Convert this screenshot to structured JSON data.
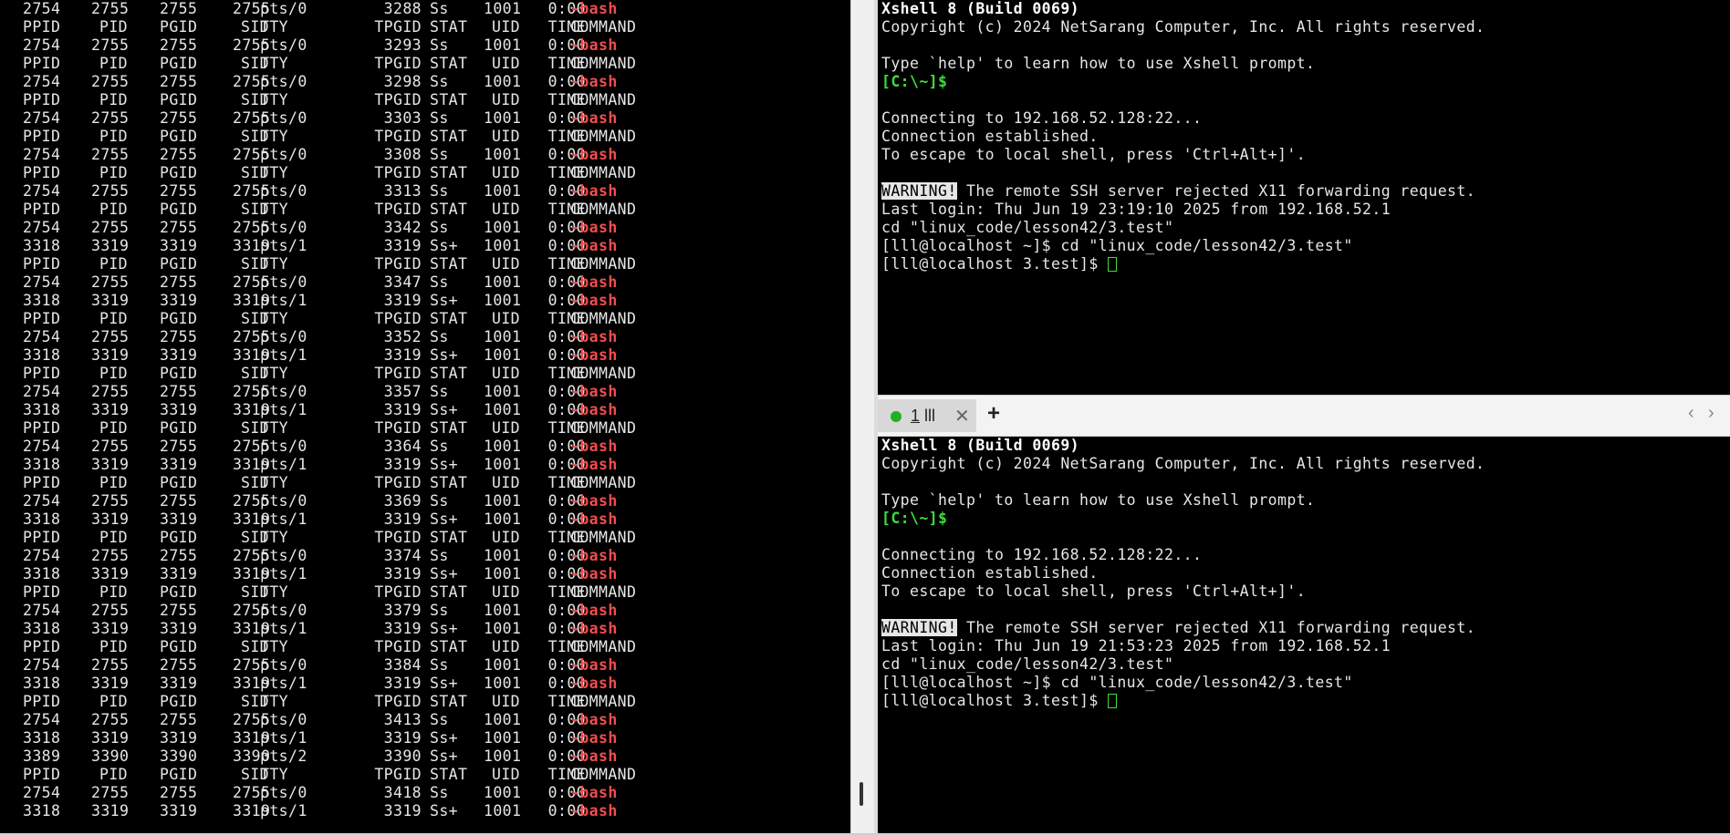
{
  "left_terminal": {
    "rows": [
      [
        "2754",
        "2755",
        "2755",
        "2755",
        "pts/0",
        "3288",
        "Ss",
        "1001",
        "0:00",
        "-bash"
      ],
      [
        "PPID",
        "PID",
        "PGID",
        "SID",
        "TTY",
        "TPGID",
        "STAT",
        "UID",
        "TIME",
        "COMMAND"
      ],
      [
        "2754",
        "2755",
        "2755",
        "2755",
        "pts/0",
        "3293",
        "Ss",
        "1001",
        "0:00",
        "-bash"
      ],
      [
        "PPID",
        "PID",
        "PGID",
        "SID",
        "TTY",
        "TPGID",
        "STAT",
        "UID",
        "TIME",
        "COMMAND"
      ],
      [
        "2754",
        "2755",
        "2755",
        "2755",
        "pts/0",
        "3298",
        "Ss",
        "1001",
        "0:00",
        "-bash"
      ],
      [
        "PPID",
        "PID",
        "PGID",
        "SID",
        "TTY",
        "TPGID",
        "STAT",
        "UID",
        "TIME",
        "COMMAND"
      ],
      [
        "2754",
        "2755",
        "2755",
        "2755",
        "pts/0",
        "3303",
        "Ss",
        "1001",
        "0:00",
        "-bash"
      ],
      [
        "PPID",
        "PID",
        "PGID",
        "SID",
        "TTY",
        "TPGID",
        "STAT",
        "UID",
        "TIME",
        "COMMAND"
      ],
      [
        "2754",
        "2755",
        "2755",
        "2755",
        "pts/0",
        "3308",
        "Ss",
        "1001",
        "0:00",
        "-bash"
      ],
      [
        "PPID",
        "PID",
        "PGID",
        "SID",
        "TTY",
        "TPGID",
        "STAT",
        "UID",
        "TIME",
        "COMMAND"
      ],
      [
        "2754",
        "2755",
        "2755",
        "2755",
        "pts/0",
        "3313",
        "Ss",
        "1001",
        "0:00",
        "-bash"
      ],
      [
        "PPID",
        "PID",
        "PGID",
        "SID",
        "TTY",
        "TPGID",
        "STAT",
        "UID",
        "TIME",
        "COMMAND"
      ],
      [
        "2754",
        "2755",
        "2755",
        "2755",
        "pts/0",
        "3342",
        "Ss",
        "1001",
        "0:00",
        "-bash"
      ],
      [
        "3318",
        "3319",
        "3319",
        "3319",
        "pts/1",
        "3319",
        "Ss+",
        "1001",
        "0:00",
        "-bash"
      ],
      [
        "PPID",
        "PID",
        "PGID",
        "SID",
        "TTY",
        "TPGID",
        "STAT",
        "UID",
        "TIME",
        "COMMAND"
      ],
      [
        "2754",
        "2755",
        "2755",
        "2755",
        "pts/0",
        "3347",
        "Ss",
        "1001",
        "0:00",
        "-bash"
      ],
      [
        "3318",
        "3319",
        "3319",
        "3319",
        "pts/1",
        "3319",
        "Ss+",
        "1001",
        "0:00",
        "-bash"
      ],
      [
        "PPID",
        "PID",
        "PGID",
        "SID",
        "TTY",
        "TPGID",
        "STAT",
        "UID",
        "TIME",
        "COMMAND"
      ],
      [
        "2754",
        "2755",
        "2755",
        "2755",
        "pts/0",
        "3352",
        "Ss",
        "1001",
        "0:00",
        "-bash"
      ],
      [
        "3318",
        "3319",
        "3319",
        "3319",
        "pts/1",
        "3319",
        "Ss+",
        "1001",
        "0:00",
        "-bash"
      ],
      [
        "PPID",
        "PID",
        "PGID",
        "SID",
        "TTY",
        "TPGID",
        "STAT",
        "UID",
        "TIME",
        "COMMAND"
      ],
      [
        "2754",
        "2755",
        "2755",
        "2755",
        "pts/0",
        "3357",
        "Ss",
        "1001",
        "0:00",
        "-bash"
      ],
      [
        "3318",
        "3319",
        "3319",
        "3319",
        "pts/1",
        "3319",
        "Ss+",
        "1001",
        "0:00",
        "-bash"
      ],
      [
        "PPID",
        "PID",
        "PGID",
        "SID",
        "TTY",
        "TPGID",
        "STAT",
        "UID",
        "TIME",
        "COMMAND"
      ],
      [
        "2754",
        "2755",
        "2755",
        "2755",
        "pts/0",
        "3364",
        "Ss",
        "1001",
        "0:00",
        "-bash"
      ],
      [
        "3318",
        "3319",
        "3319",
        "3319",
        "pts/1",
        "3319",
        "Ss+",
        "1001",
        "0:00",
        "-bash"
      ],
      [
        "PPID",
        "PID",
        "PGID",
        "SID",
        "TTY",
        "TPGID",
        "STAT",
        "UID",
        "TIME",
        "COMMAND"
      ],
      [
        "2754",
        "2755",
        "2755",
        "2755",
        "pts/0",
        "3369",
        "Ss",
        "1001",
        "0:00",
        "-bash"
      ],
      [
        "3318",
        "3319",
        "3319",
        "3319",
        "pts/1",
        "3319",
        "Ss+",
        "1001",
        "0:00",
        "-bash"
      ],
      [
        "PPID",
        "PID",
        "PGID",
        "SID",
        "TTY",
        "TPGID",
        "STAT",
        "UID",
        "TIME",
        "COMMAND"
      ],
      [
        "2754",
        "2755",
        "2755",
        "2755",
        "pts/0",
        "3374",
        "Ss",
        "1001",
        "0:00",
        "-bash"
      ],
      [
        "3318",
        "3319",
        "3319",
        "3319",
        "pts/1",
        "3319",
        "Ss+",
        "1001",
        "0:00",
        "-bash"
      ],
      [
        "PPID",
        "PID",
        "PGID",
        "SID",
        "TTY",
        "TPGID",
        "STAT",
        "UID",
        "TIME",
        "COMMAND"
      ],
      [
        "2754",
        "2755",
        "2755",
        "2755",
        "pts/0",
        "3379",
        "Ss",
        "1001",
        "0:00",
        "-bash"
      ],
      [
        "3318",
        "3319",
        "3319",
        "3319",
        "pts/1",
        "3319",
        "Ss+",
        "1001",
        "0:00",
        "-bash"
      ],
      [
        "PPID",
        "PID",
        "PGID",
        "SID",
        "TTY",
        "TPGID",
        "STAT",
        "UID",
        "TIME",
        "COMMAND"
      ],
      [
        "2754",
        "2755",
        "2755",
        "2755",
        "pts/0",
        "3384",
        "Ss",
        "1001",
        "0:00",
        "-bash"
      ],
      [
        "3318",
        "3319",
        "3319",
        "3319",
        "pts/1",
        "3319",
        "Ss+",
        "1001",
        "0:00",
        "-bash"
      ],
      [
        "PPID",
        "PID",
        "PGID",
        "SID",
        "TTY",
        "TPGID",
        "STAT",
        "UID",
        "TIME",
        "COMMAND"
      ],
      [
        "2754",
        "2755",
        "2755",
        "2755",
        "pts/0",
        "3413",
        "Ss",
        "1001",
        "0:00",
        "-bash"
      ],
      [
        "3318",
        "3319",
        "3319",
        "3319",
        "pts/1",
        "3319",
        "Ss+",
        "1001",
        "0:00",
        "-bash"
      ],
      [
        "3389",
        "3390",
        "3390",
        "3390",
        "pts/2",
        "3390",
        "Ss+",
        "1001",
        "0:00",
        "-bash"
      ],
      [
        "PPID",
        "PID",
        "PGID",
        "SID",
        "TTY",
        "TPGID",
        "STAT",
        "UID",
        "TIME",
        "COMMAND"
      ],
      [
        "2754",
        "2755",
        "2755",
        "2755",
        "pts/0",
        "3418",
        "Ss",
        "1001",
        "0:00",
        "-bash"
      ],
      [
        "3318",
        "3319",
        "3319",
        "3319",
        "pts/1",
        "3319",
        "Ss+",
        "1001",
        "0:00",
        "-bash"
      ]
    ]
  },
  "right_top_terminal": {
    "banner": "Xshell 8 (Build 0069)",
    "copyright": "Copyright (c) 2024 NetSarang Computer, Inc. All rights reserved.",
    "help_hint": "Type `help' to learn how to use Xshell prompt.",
    "local_prompt": "[C:\\~]$",
    "connecting": "Connecting to 192.168.52.128:22...",
    "established": "Connection established.",
    "escape_hint": "To escape to local shell, press 'Ctrl+Alt+]'.",
    "warning_tag": "WARNING!",
    "warning_text": " The remote SSH server rejected X11 forwarding request.",
    "last_login": "Last login: Thu Jun 19 23:19:10 2025 from 192.168.52.1",
    "cd_echo": "cd \"linux_code/lesson42/3.test\"",
    "prompt_cd": "[lll@localhost ~]$ cd \"linux_code/lesson42/3.test\"",
    "prompt_current": "[lll@localhost 3.test]$ "
  },
  "tab_bar": {
    "tab_number": "1",
    "tab_name": " lll",
    "close_glyph": "✕",
    "add_glyph": "+",
    "prev_glyph": "‹",
    "next_glyph": "›",
    "status_color": "#20b020"
  },
  "right_bottom_terminal": {
    "banner": "Xshell 8 (Build 0069)",
    "copyright": "Copyright (c) 2024 NetSarang Computer, Inc. All rights reserved.",
    "help_hint": "Type `help' to learn how to use Xshell prompt.",
    "local_prompt": "[C:\\~]$",
    "connecting": "Connecting to 192.168.52.128:22...",
    "established": "Connection established.",
    "escape_hint": "To escape to local shell, press 'Ctrl+Alt+]'.",
    "warning_tag": "WARNING!",
    "warning_text": " The remote SSH server rejected X11 forwarding request.",
    "last_login": "Last login: Thu Jun 19 21:53:23 2025 from 192.168.52.1",
    "cd_echo": "cd \"linux_code/lesson42/3.test\"",
    "prompt_cd": "[lll@localhost ~]$ cd \"linux_code/lesson42/3.test\"",
    "prompt_current": "[lll@localhost 3.test]$ "
  }
}
